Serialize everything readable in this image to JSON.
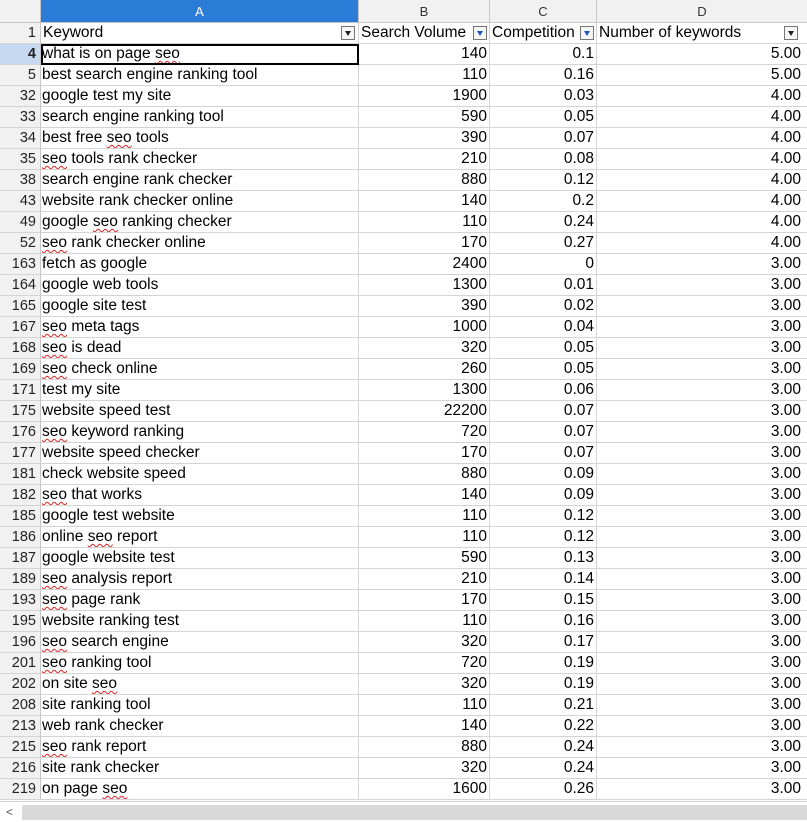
{
  "columns": [
    "A",
    "B",
    "C",
    "D"
  ],
  "header_row": {
    "row_number": "1",
    "keyword": "Keyword",
    "search_volume": "Search Volume",
    "competition": "Competition",
    "num_keywords": "Number of keywords"
  },
  "selected_cell": "A4",
  "rows": [
    {
      "n": "4",
      "kw": "what is on page seo",
      "vol": "140",
      "comp": "0.1",
      "num": "5.00"
    },
    {
      "n": "5",
      "kw": "best search engine ranking tool",
      "vol": "110",
      "comp": "0.16",
      "num": "5.00"
    },
    {
      "n": "32",
      "kw": "google test my site",
      "vol": "1900",
      "comp": "0.03",
      "num": "4.00"
    },
    {
      "n": "33",
      "kw": "search engine ranking tool",
      "vol": "590",
      "comp": "0.05",
      "num": "4.00"
    },
    {
      "n": "34",
      "kw": "best free seo tools",
      "vol": "390",
      "comp": "0.07",
      "num": "4.00"
    },
    {
      "n": "35",
      "kw": "seo tools rank checker",
      "vol": "210",
      "comp": "0.08",
      "num": "4.00"
    },
    {
      "n": "38",
      "kw": "search engine rank checker",
      "vol": "880",
      "comp": "0.12",
      "num": "4.00"
    },
    {
      "n": "43",
      "kw": "website rank checker online",
      "vol": "140",
      "comp": "0.2",
      "num": "4.00"
    },
    {
      "n": "49",
      "kw": "google seo ranking checker",
      "vol": "110",
      "comp": "0.24",
      "num": "4.00"
    },
    {
      "n": "52",
      "kw": "seo rank checker online",
      "vol": "170",
      "comp": "0.27",
      "num": "4.00"
    },
    {
      "n": "163",
      "kw": "fetch as google",
      "vol": "2400",
      "comp": "0",
      "num": "3.00"
    },
    {
      "n": "164",
      "kw": "google web tools",
      "vol": "1300",
      "comp": "0.01",
      "num": "3.00"
    },
    {
      "n": "165",
      "kw": "google site test",
      "vol": "390",
      "comp": "0.02",
      "num": "3.00"
    },
    {
      "n": "167",
      "kw": "seo meta tags",
      "vol": "1000",
      "comp": "0.04",
      "num": "3.00"
    },
    {
      "n": "168",
      "kw": "seo is dead",
      "vol": "320",
      "comp": "0.05",
      "num": "3.00"
    },
    {
      "n": "169",
      "kw": "seo check online",
      "vol": "260",
      "comp": "0.05",
      "num": "3.00"
    },
    {
      "n": "171",
      "kw": "test my site",
      "vol": "1300",
      "comp": "0.06",
      "num": "3.00"
    },
    {
      "n": "175",
      "kw": "website speed test",
      "vol": "22200",
      "comp": "0.07",
      "num": "3.00"
    },
    {
      "n": "176",
      "kw": "seo keyword ranking",
      "vol": "720",
      "comp": "0.07",
      "num": "3.00"
    },
    {
      "n": "177",
      "kw": "website speed checker",
      "vol": "170",
      "comp": "0.07",
      "num": "3.00"
    },
    {
      "n": "181",
      "kw": "check website speed",
      "vol": "880",
      "comp": "0.09",
      "num": "3.00"
    },
    {
      "n": "182",
      "kw": "seo that works",
      "vol": "140",
      "comp": "0.09",
      "num": "3.00"
    },
    {
      "n": "185",
      "kw": "google test website",
      "vol": "110",
      "comp": "0.12",
      "num": "3.00"
    },
    {
      "n": "186",
      "kw": "online seo report",
      "vol": "110",
      "comp": "0.12",
      "num": "3.00"
    },
    {
      "n": "187",
      "kw": "google website test",
      "vol": "590",
      "comp": "0.13",
      "num": "3.00"
    },
    {
      "n": "189",
      "kw": "seo analysis report",
      "vol": "210",
      "comp": "0.14",
      "num": "3.00"
    },
    {
      "n": "193",
      "kw": "seo page rank",
      "vol": "170",
      "comp": "0.15",
      "num": "3.00"
    },
    {
      "n": "195",
      "kw": "website ranking test",
      "vol": "110",
      "comp": "0.16",
      "num": "3.00"
    },
    {
      "n": "196",
      "kw": "seo search engine",
      "vol": "320",
      "comp": "0.17",
      "num": "3.00"
    },
    {
      "n": "201",
      "kw": "seo ranking tool",
      "vol": "720",
      "comp": "0.19",
      "num": "3.00"
    },
    {
      "n": "202",
      "kw": "on site seo",
      "vol": "320",
      "comp": "0.19",
      "num": "3.00"
    },
    {
      "n": "208",
      "kw": "site ranking tool",
      "vol": "110",
      "comp": "0.21",
      "num": "3.00"
    },
    {
      "n": "213",
      "kw": "web rank checker",
      "vol": "140",
      "comp": "0.22",
      "num": "3.00"
    },
    {
      "n": "215",
      "kw": "seo rank report",
      "vol": "880",
      "comp": "0.24",
      "num": "3.00"
    },
    {
      "n": "216",
      "kw": "site rank checker",
      "vol": "320",
      "comp": "0.24",
      "num": "3.00"
    },
    {
      "n": "219",
      "kw": "on page seo",
      "vol": "1600",
      "comp": "0.26",
      "num": "3.00"
    }
  ],
  "spellcheck_word": "seo",
  "scroll_left_glyph": "<"
}
